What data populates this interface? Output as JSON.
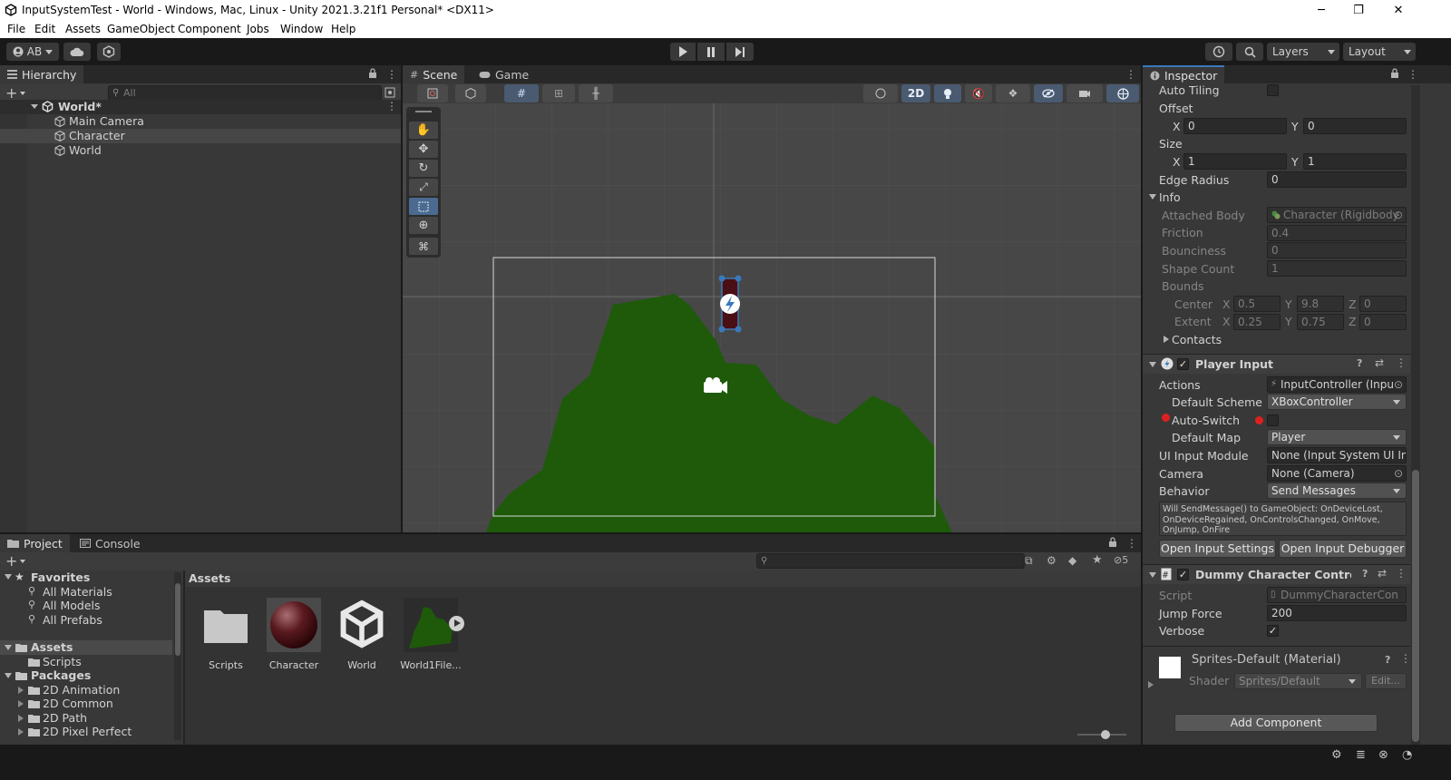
{
  "window": {
    "title": "InputSystemTest - World - Windows, Mac, Linux - Unity 2021.3.21f1 Personal* <DX11>",
    "minimize": "─",
    "maximize": "❐",
    "close": "✕"
  },
  "menu": [
    "File",
    "Edit",
    "Assets",
    "GameObject",
    "Component",
    "Jobs",
    "Window",
    "Help"
  ],
  "toolbar": {
    "account": "AB",
    "layers": "Layers",
    "layout": "Layout"
  },
  "hierarchy": {
    "tab": "Hierarchy",
    "search_placeholder": "All",
    "root": "World*",
    "items": [
      "Main Camera",
      "Character",
      "World"
    ]
  },
  "scene_tabs": {
    "scene": "Scene",
    "game": "Game",
    "mode2d": "2D"
  },
  "inspector": {
    "tab": "Inspector",
    "auto_tiling": "Auto Tiling",
    "offset": "Offset",
    "offset_x_label": "X",
    "offset_x": "0",
    "offset_y_label": "Y",
    "offset_y": "0",
    "size": "Size",
    "size_x_label": "X",
    "size_x": "1",
    "size_y_label": "Y",
    "size_y": "1",
    "edge_radius": "Edge Radius",
    "edge_radius_val": "0",
    "info": "Info",
    "attached_body": "Attached Body",
    "attached_body_val": "Character (Rigidbody",
    "friction": "Friction",
    "friction_val": "0.4",
    "bounciness": "Bounciness",
    "bounciness_val": "0",
    "shape_count": "Shape Count",
    "shape_count_val": "1",
    "bounds": "Bounds",
    "center": "Center",
    "center_x": "0.5",
    "center_y": "9.8",
    "center_z": "0",
    "extent": "Extent",
    "extent_x": "0.25",
    "extent_y": "0.75",
    "extent_z": "0",
    "axis_x": "X",
    "axis_y": "Y",
    "axis_z": "Z",
    "contacts": "Contacts",
    "player_input": {
      "title": "Player Input",
      "actions": "Actions",
      "actions_val": "InputController (Input",
      "default_scheme": "Default Scheme",
      "default_scheme_val": "XBoxController",
      "auto_switch": "Auto-Switch",
      "default_map": "Default Map",
      "default_map_val": "Player",
      "ui_input_module": "UI Input Module",
      "ui_input_module_val": "None (Input System UI In",
      "camera": "Camera",
      "camera_val": "None (Camera)",
      "behavior": "Behavior",
      "behavior_val": "Send Messages",
      "help": "Will SendMessage() to GameObject: OnDeviceLost, OnDeviceRegained, OnControlsChanged, OnMove, OnJump, OnFire",
      "open_settings": "Open Input Settings",
      "open_debugger": "Open Input Debugger"
    },
    "dummy": {
      "title": "Dummy Character Controller (",
      "script": "Script",
      "script_val": "DummyCharacterCon",
      "jump_force": "Jump Force",
      "jump_force_val": "200",
      "verbose": "Verbose"
    },
    "material": {
      "title": "Sprites-Default (Material)",
      "shader": "Shader",
      "shader_val": "Sprites/Default",
      "edit": "Edit..."
    },
    "add_component": "Add Component"
  },
  "project": {
    "tab_project": "Project",
    "tab_console": "Console",
    "favorites": "Favorites",
    "favorite_items": [
      "All Materials",
      "All Models",
      "All Prefabs"
    ],
    "assets": "Assets",
    "asset_children": [
      "Scripts"
    ],
    "packages": "Packages",
    "package_items": [
      "2D Animation",
      "2D Common",
      "2D Path",
      "2D Pixel Perfect"
    ],
    "breadcrumb": "Assets",
    "grid": [
      "Scripts",
      "Character",
      "World",
      "World1File..."
    ],
    "hidden_count": "5"
  },
  "colors": {
    "ground": "#1e5a0a",
    "character": "#4a0f14",
    "accent": "#3a79bb",
    "panel": "#383838"
  }
}
